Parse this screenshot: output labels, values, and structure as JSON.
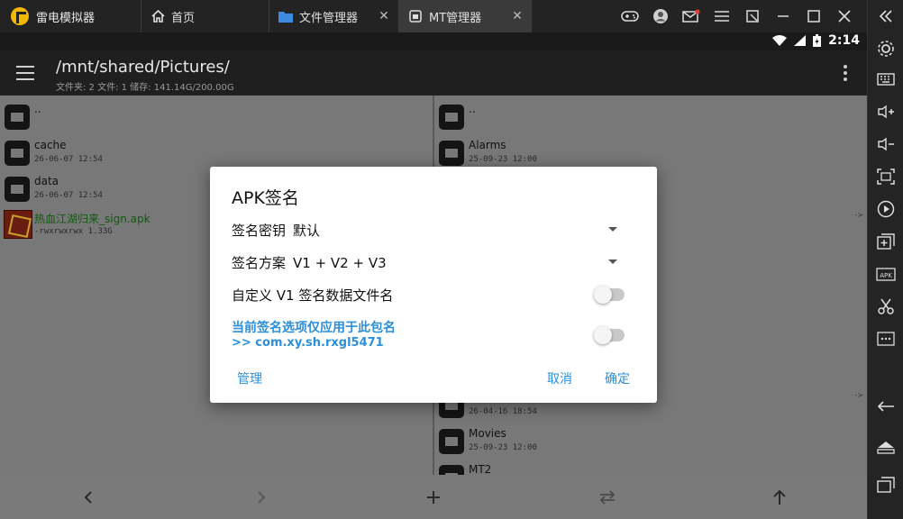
{
  "colors": {
    "accent": "#2b8fdc",
    "apk_name": "#0e5a0e"
  },
  "emulator": {
    "brand": "雷电模拟器",
    "tabs": [
      {
        "label": "首页",
        "icon": "home-icon"
      },
      {
        "label": "文件管理器",
        "icon": "folder-icon"
      },
      {
        "label": "MT管理器",
        "icon": "mt-app-icon"
      }
    ],
    "title_icons": [
      "gamepad-icon",
      "account-icon",
      "mail-icon",
      "menu-icon",
      "fullscreen-icon",
      "minimize-icon",
      "maximize-icon",
      "close-icon"
    ],
    "side_icons": [
      "collapse-icon",
      "settings-icon",
      "keyboard-icon",
      "volume-up-icon",
      "volume-down-icon",
      "screenshot-icon",
      "play-record-icon",
      "add-apk-icon",
      "apk-install-icon",
      "scissors-icon",
      "more-icon",
      "back-icon",
      "home-nav-icon",
      "recents-icon"
    ]
  },
  "status": {
    "time": "2:14"
  },
  "appbar": {
    "path": "/mnt/shared/Pictures/",
    "info": "文件夹: 2  文件: 1  储存: 141.14G/200.00G"
  },
  "left_pane": {
    "items": [
      {
        "name": "..",
        "meta": ""
      },
      {
        "name": "cache",
        "meta": "26-06-07 12:54"
      },
      {
        "name": "data",
        "meta": "26-06-07 12:54"
      },
      {
        "name": "热血江湖归来_sign.apk",
        "meta": "-rwxrwxrwx  1.33G"
      }
    ]
  },
  "right_pane": {
    "items": [
      {
        "name": "..",
        "meta": ""
      },
      {
        "name": "Alarms",
        "meta": "25-09-23 12:00"
      },
      {
        "name": "",
        "meta": "26-04-16 18:54"
      },
      {
        "name": "Movies",
        "meta": "25-09-23 12:00"
      },
      {
        "name": "MT2",
        "meta": ""
      }
    ],
    "arrow_marks": [
      "->",
      "->"
    ]
  },
  "dialog": {
    "title": "APK签名",
    "key_label": "签名密钥",
    "key_value": "默认",
    "scheme_label": "签名方案",
    "scheme_value": "V1 + V2 + V3",
    "custom_v1_label": "自定义 V1 签名数据文件名",
    "custom_v1_on": false,
    "package_note": "当前签名选项仅应用于此包名",
    "package_name": ">> com.xy.sh.rxgl5471",
    "package_only_on": false,
    "manage_label": "管理",
    "cancel_label": "取消",
    "confirm_label": "确定"
  },
  "bottom": {
    "icons": [
      "back-arrow-icon",
      "forward-arrow-icon",
      "add-icon",
      "swap-icon",
      "up-arrow-icon"
    ]
  }
}
